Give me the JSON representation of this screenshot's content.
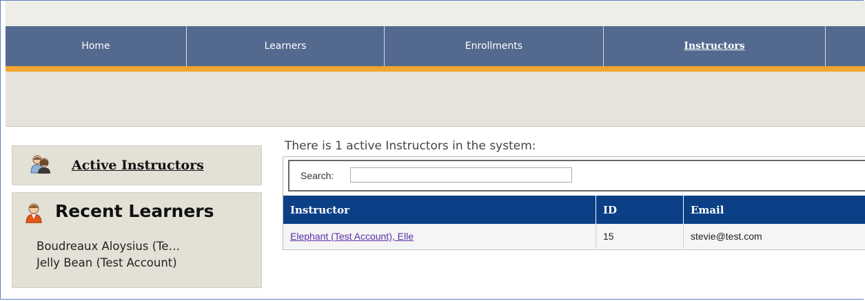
{
  "nav": {
    "items": [
      {
        "label": "Home",
        "active": false
      },
      {
        "label": "Learners",
        "active": false
      },
      {
        "label": "Enrollments",
        "active": false
      },
      {
        "label": "Instructors",
        "active": true
      }
    ]
  },
  "sidebar": {
    "active_instructors_label": "Active Instructors",
    "recent_learners_title": "Recent Learners",
    "recent_learners": [
      "Boudreaux Aloysius (Te…",
      "Jelly Bean (Test Account)"
    ]
  },
  "main": {
    "heading": "There is 1 active Instructors in the system:",
    "search": {
      "label": "Search:",
      "value": ""
    },
    "table": {
      "columns": [
        "Instructor",
        "ID",
        "Email"
      ],
      "rows": [
        {
          "instructor": "Elephant (Test Account), Elle",
          "id": "15",
          "email": "stevie@test.com"
        }
      ]
    }
  },
  "colors": {
    "nav_bg": "#53698f",
    "accent_orange": "#f4a531",
    "table_header": "#0b3f86",
    "link": "#5a2ea8"
  }
}
